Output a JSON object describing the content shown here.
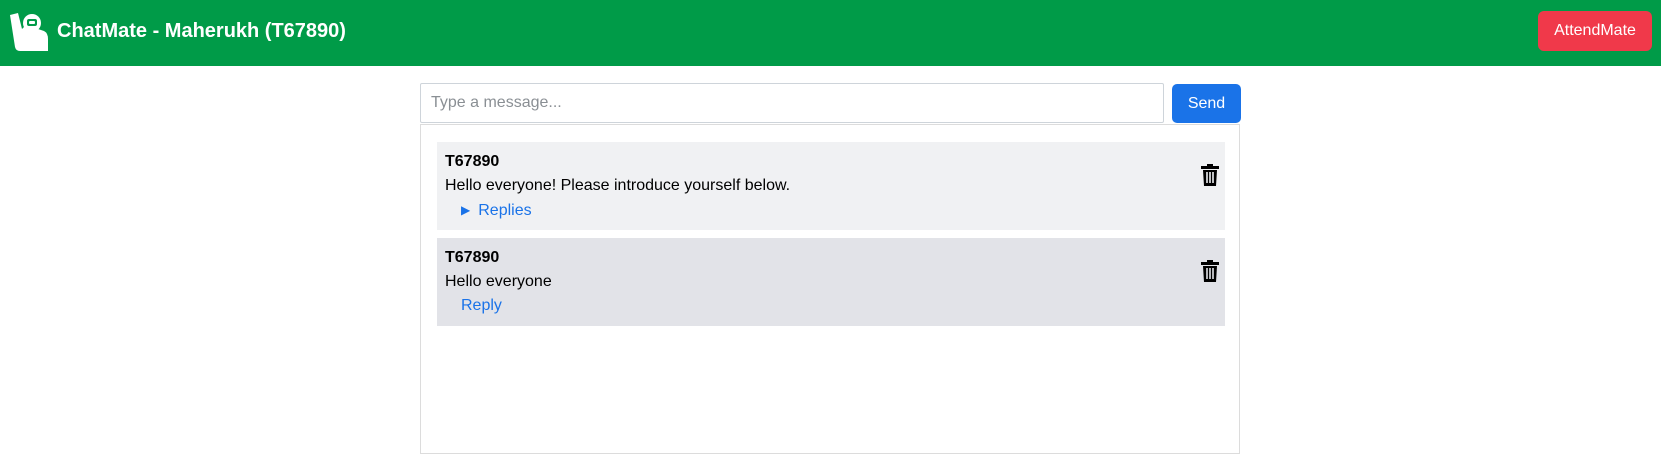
{
  "header": {
    "app_title": "ChatMate - Maherukh (T67890)",
    "logo_icon": "hand-raise-icon",
    "attend_button": "AttendMate",
    "bar_color": "#009b48",
    "attend_button_color": "#f0394a"
  },
  "composer": {
    "placeholder": "Type a message...",
    "value": "",
    "send_label": "Send",
    "send_color": "#1a73e8"
  },
  "messages": [
    {
      "author": "T67890",
      "text": "Hello everyone! Please introduce yourself below.",
      "link_label": "Replies",
      "link_icon": "caret-right-icon",
      "delete_icon": "trash-icon"
    },
    {
      "author": "T67890",
      "text": "Hello everyone",
      "link_label": "Reply",
      "delete_icon": "trash-icon"
    }
  ]
}
